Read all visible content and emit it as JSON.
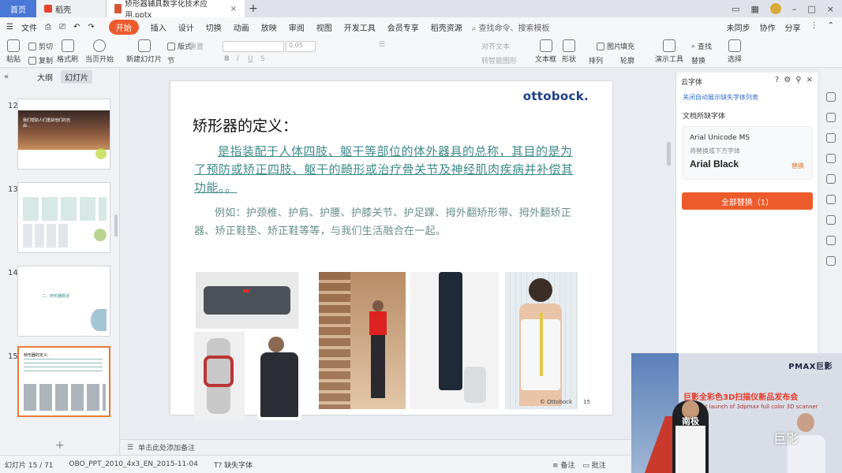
{
  "tabs": {
    "home": "首页",
    "daoke": "稻壳",
    "doc": "矫形器辅具数字化技术应用.pptx"
  },
  "menubar": {
    "file": "文件",
    "tabs": [
      "开始",
      "插入",
      "设计",
      "切换",
      "动画",
      "放映",
      "审阅",
      "视图",
      "开发工具",
      "会员专享",
      "稻壳资源"
    ],
    "active_index": 0,
    "search": "查找命令、搜索模板",
    "right": [
      "未同步",
      "协作",
      "分享"
    ]
  },
  "ribbon": {
    "paste": "粘贴",
    "cut": "剪切",
    "copy": "复制",
    "format_painter": "格式刷",
    "from_start": "当页开始",
    "new_slide": "新建幻灯片",
    "layout": "版式",
    "section": "节",
    "reset": "重置",
    "font_size": "0.05",
    "text_direction": "对齐文本",
    "convert_smartart": "转智能图形",
    "textbox": "文本框",
    "shape": "形状",
    "arrange": "排列",
    "picture": "图片",
    "fill": "填充",
    "outline": "轮廓",
    "presenter_tools": "演示工具",
    "find": "查找",
    "replace": "替换",
    "select": "选择"
  },
  "leftpanel": {
    "outline_tab": "大纲",
    "slides_tab": "幻灯片",
    "thumbs": [
      {
        "num": "12",
        "text": "我们帮助人们重获他们的自由..."
      },
      {
        "num": "13",
        "text": ""
      },
      {
        "num": "14",
        "text": "二、矫形器概述"
      },
      {
        "num": "15",
        "text": "矫形器的定义:"
      }
    ]
  },
  "slide": {
    "logo": "ottobock.",
    "title": "矫形器的定义：",
    "definition": "是指装配于人体四肢、躯干等部位的体外器具的总称，其目的是为了预防或矫正四肢、躯干的畸形或治疗骨关节及神经肌肉疾病并补偿其功能。。",
    "example": "例如：护颈椎、护肩、护腰、护膝关节、护足踝、拇外翻矫形带、拇外翻矫正器、矫正鞋垫、矫正鞋等等，与我们生活融合在一起。",
    "footer_copy": "© Ottobock",
    "footer_page": "15"
  },
  "notes": {
    "placeholder": "单击此处添加备注"
  },
  "status": {
    "slide_count": "幻灯片 15 / 71",
    "theme": "OBO_PPT_2010_4x3_EN_2015-11-04",
    "missing_font": "缺失字体",
    "notes": "备注",
    "comments": "批注"
  },
  "fontpanel": {
    "header": "云字体",
    "link": "关闭自动展示缺失字体列表",
    "label": "文档所缺字体",
    "font_missing": "Arial Unicode MS",
    "hint": "将替换成下方字体",
    "font_replacement": "Arial Black",
    "replace_link": "替换",
    "replace_all": "全部替换（1）"
  },
  "video": {
    "brand": "PMAX巨影",
    "title": "巨影全彩色3D扫描仪新品发布会",
    "subtitle": "Product launch of 3dpmax full color 3D scanner",
    "name": "南极",
    "logo": "巨影"
  },
  "colors": {
    "accent": "#ed5b2c",
    "home_tab": "#4a78d6",
    "teal_text": "#3f8a8a",
    "brand": "#1c3f8a"
  }
}
